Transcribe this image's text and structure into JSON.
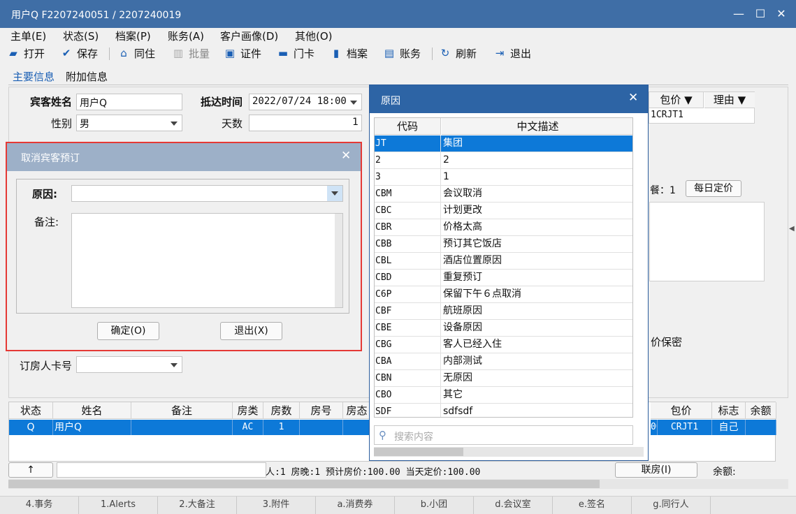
{
  "window": {
    "title": "用户Q  F2207240051  /  2207240019"
  },
  "menu": [
    "主单(E)",
    "状态(S)",
    "档案(P)",
    "账务(A)",
    "客户画像(D)",
    "其他(O)"
  ],
  "toolbar": {
    "open": "打开",
    "save": "保存",
    "share": "同住",
    "batch": "批量",
    "id_card": "证件",
    "door_card": "门卡",
    "profile": "档案",
    "account": "账务",
    "refresh": "刷新",
    "exit": "退出"
  },
  "tabs": {
    "main": "主要信息",
    "extra": "附加信息"
  },
  "form": {
    "guest_name_label": "宾客姓名",
    "guest_name": "用户Q",
    "arrival_label": "抵达时间",
    "arrival": "2022/07/24 18:00",
    "gender_label": "性别",
    "gender": "男",
    "days_label": "天数",
    "days": "1",
    "card_label": "订房人卡号",
    "card": ""
  },
  "right_area": {
    "col_price": "包价",
    "col_reason": "理由",
    "cell_price": "1CRJT1",
    "meal_text": "餐：1",
    "daily_price_button": "每日定价",
    "price_secret": "价保密"
  },
  "grid": {
    "headers": [
      "状态",
      "姓名",
      "备注",
      "房类",
      "房数",
      "房号",
      "房态",
      "包价",
      "标志",
      "余额"
    ],
    "row": {
      "status": "Q",
      "name": "用户Q",
      "remark": "",
      "room_type": "AC",
      "rooms": "1",
      "room_no": "",
      "room_state": "",
      "partial": "00",
      "package": "CRJT1",
      "flag": "自己"
    }
  },
  "status_bar": {
    "up_button": "↑",
    "summary": "人:1  房晚:1  预计房价:100.00  当天定价:100.00",
    "link_room_button": "联房(I)",
    "balance_label": "余额:"
  },
  "footer_tabs": [
    "4.事务",
    "1.Alerts",
    "2.大备注",
    "3.附件",
    "a.消费券",
    "b.小团",
    "d.会议室",
    "e.签名",
    "g.同行人"
  ],
  "cancel_dialog": {
    "title": "取消宾客预订",
    "reason_label": "原因:",
    "reason_value": "",
    "note_label": "备注:",
    "note_value": "",
    "ok_button": "确定(O)",
    "exit_button": "退出(X)"
  },
  "reason_popup": {
    "title": "原因",
    "col_code": "代码",
    "col_desc": "中文描述",
    "rows": [
      {
        "code": "JT",
        "desc": "集团"
      },
      {
        "code": "2",
        "desc": "2"
      },
      {
        "code": "3",
        "desc": "1"
      },
      {
        "code": "CBM",
        "desc": "会议取消"
      },
      {
        "code": "CBC",
        "desc": "计划更改"
      },
      {
        "code": "CBR",
        "desc": "价格太高"
      },
      {
        "code": "CBB",
        "desc": "预订其它饭店"
      },
      {
        "code": "CBL",
        "desc": "酒店位置原因"
      },
      {
        "code": "CBD",
        "desc": "重复预订"
      },
      {
        "code": "C6P",
        "desc": "保留下午６点取消"
      },
      {
        "code": "CBF",
        "desc": "航班原因"
      },
      {
        "code": "CBE",
        "desc": "设备原因"
      },
      {
        "code": "CBG",
        "desc": "客人已经入住"
      },
      {
        "code": "CBA",
        "desc": "内部测试"
      },
      {
        "code": "CBN",
        "desc": "无原因"
      },
      {
        "code": "CBO",
        "desc": "其它"
      },
      {
        "code": "SDF",
        "desc": "sdfsdf"
      }
    ],
    "search_placeholder": "搜索内容"
  }
}
